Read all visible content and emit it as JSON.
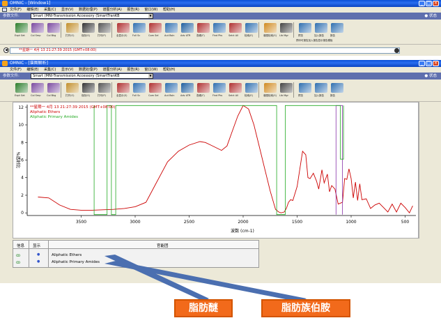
{
  "window1": {
    "title": "OMNIC - [Window1]",
    "menu": [
      "文件(F)",
      "编辑(E)",
      "采集(C)",
      "显示(V)",
      "数据处理(P)",
      "谱图分析(A)",
      "报告(R)",
      "窗口(W)",
      "帮助(H)"
    ],
    "exp_label": "参数文件:",
    "exp_value": "Smart (MNI-Transmission Accessory  (SmartTranKB",
    "status": "状态",
    "spectrum_field": "**星期一 4月 13 21:27:39 2015 (GMT+08:00)"
  },
  "window2": {
    "title": "OMNIC - [谱图解析]",
    "menu": [
      "文件(F)",
      "编辑(E)",
      "采集(C)",
      "显示(V)",
      "数据处理(P)",
      "谱图分析(A)",
      "报告(R)",
      "窗口(W)",
      "帮助(H)"
    ],
    "exp_label": "参数文件:",
    "exp_value": "Smart (MNI-Transmission Accessory  (SmartTranKB",
    "status": "状态"
  },
  "toolbar": [
    {
      "label": "Expt Set",
      "icon": "expt-set-icon",
      "color": "#2b7d2b"
    },
    {
      "label": "Col Smp",
      "icon": "collect-sample-icon",
      "color": "#7a4aa0"
    },
    {
      "label": "Col Bkg",
      "icon": "collect-background-icon",
      "color": "#7a4aa0"
    },
    {
      "label": "打开(O)",
      "icon": "open-icon",
      "color": "#c28f2c"
    },
    {
      "label": "保存(S)",
      "icon": "save-icon",
      "color": "#333333"
    },
    {
      "label": "打印(P)",
      "icon": "print-icon",
      "color": "#555555"
    },
    {
      "label": "全显示(S)",
      "icon": "full-display-icon",
      "color": "#b03030"
    },
    {
      "label": "Full Sc",
      "icon": "full-scale-icon",
      "color": "#2f6fb0"
    },
    {
      "label": "Com Sel",
      "icon": "common-scale-icon",
      "color": "#b03030"
    },
    {
      "label": "Aut Bsln",
      "icon": "auto-baseline-icon",
      "color": "#2f6fb0"
    },
    {
      "label": "Adv ATR",
      "icon": "adv-atr-icon",
      "color": "#1f5f9f"
    },
    {
      "label": "查峰(F)",
      "icon": "find-peaks-icon",
      "color": "#b03030"
    },
    {
      "label": "Find Pks",
      "icon": "find-pks-icon",
      "color": "#2f6fb0"
    },
    {
      "label": "Selct All",
      "icon": "select-all-icon",
      "color": "#b03030"
    },
    {
      "label": "检索(E)",
      "icon": "search-library-icon",
      "color": "#2f6fb0"
    },
    {
      "label": "谱图检索(S)",
      "icon": "spectral-search-icon",
      "color": "#d08a20"
    },
    {
      "label": "Lib Mgr",
      "icon": "library-manager-icon",
      "color": "#444444"
    },
    {
      "label": "预览",
      "icon": "preview-icon",
      "color": "#2f6fb0"
    },
    {
      "label": "加入报告",
      "icon": "add-report-icon",
      "color": "#2f6fb0"
    },
    {
      "label": "报告",
      "icon": "report-icon",
      "color": "#2f6fb0"
    }
  ],
  "toolbar_caption": "预印可报告加入报告显示报告模板",
  "plot": {
    "legend": [
      {
        "text": "**星期一 4月 13 21:27:39 2015 (GMT+08:00)",
        "color": "#cc0000"
      },
      {
        "text": "Aliphatic Ethers",
        "color": "#cc0000"
      },
      {
        "text": "Aliphatic Primary Amides",
        "color": "#22aa22"
      }
    ]
  },
  "chart_data": {
    "type": "line",
    "xlabel": "波数 (cm-1)",
    "ylabel": "%透射比",
    "xlim": [
      4000,
      400
    ],
    "ylim": [
      -0.3,
      12.3
    ],
    "xticks": [
      3500,
      3000,
      2500,
      2000,
      1500,
      1000,
      500
    ],
    "yticks": [
      0,
      2,
      4,
      6,
      8,
      10,
      12
    ],
    "series": [
      {
        "name": "**星期一 4月 13 21:27:39 2015 (GMT+08:00)",
        "color": "#cc0000",
        "x": [
          3900,
          3800,
          3700,
          3600,
          3500,
          3400,
          3300,
          3200,
          3100,
          3000,
          2900,
          2800,
          2700,
          2600,
          2500,
          2400,
          2350,
          2300,
          2200,
          2150,
          2100,
          2050,
          2000,
          1950,
          1900,
          1850,
          1800,
          1750,
          1700,
          1670,
          1650,
          1620,
          1600,
          1580,
          1560,
          1540,
          1500,
          1450,
          1420,
          1400,
          1380,
          1350,
          1320,
          1300,
          1270,
          1250,
          1220,
          1200,
          1180,
          1150,
          1120,
          1100,
          1080,
          1060,
          1040,
          1020,
          1000,
          980,
          960,
          940,
          920,
          900,
          860,
          820,
          780,
          740,
          700,
          660,
          620,
          580,
          540,
          500,
          460,
          430
        ],
        "y": [
          1.8,
          1.7,
          0.9,
          0.4,
          0.3,
          0.3,
          0.35,
          0.4,
          0.5,
          0.7,
          1.2,
          3.5,
          5.8,
          7.0,
          7.7,
          8.1,
          8.0,
          7.7,
          7.1,
          7.6,
          9.3,
          11.0,
          12.2,
          11.8,
          10.0,
          7.5,
          5.0,
          2.5,
          0.4,
          0.1,
          0.0,
          0.1,
          0.5,
          1.2,
          1.5,
          1.4,
          3.0,
          7.0,
          6.6,
          4.0,
          3.9,
          4.5,
          3.6,
          2.7,
          4.9,
          3.4,
          4.4,
          2.4,
          3.1,
          2.7,
          1.0,
          1.1,
          1.2,
          3.9,
          3.8,
          5.0,
          3.9,
          1.7,
          3.5,
          1.4,
          3.3,
          1.5,
          1.6,
          0.5,
          0.9,
          1.1,
          0.6,
          0.1,
          1.0,
          0.1,
          1.1,
          0.6,
          0.0,
          0.8
        ]
      },
      {
        "name": "Aliphatic Ethers",
        "color": "#8833aa",
        "x": [
          1140,
          1140,
          1080,
          1080
        ],
        "y": [
          -0.2,
          12.2,
          12.2,
          -0.2
        ]
      },
      {
        "name": "Aliphatic Primary Amides",
        "color": "#22aa22",
        "x": [
          3380,
          3380,
          3260,
          3260,
          3220,
          3220,
          3180,
          3180,
          3150,
          3150,
          1690,
          1690,
          1610,
          1610,
          1100,
          1100,
          1070,
          1070
        ],
        "y": [
          12.2,
          -0.2,
          -0.2,
          12.2,
          12.2,
          -0.2,
          -0.2,
          12.2,
          12.2,
          12.2,
          12.2,
          -0.2,
          -0.2,
          12.2,
          12.2,
          6.1,
          6.1,
          12.2
        ]
      }
    ]
  },
  "info_panel": {
    "col_info": "信息",
    "col_display": "显示",
    "col_group": "官能团",
    "rows": [
      {
        "display": "●",
        "group": "Aliphatic Ethers"
      },
      {
        "display": "●",
        "group": "Aliphatic Primary Amides"
      }
    ]
  },
  "callouts": {
    "ether": "脂肪醚",
    "amide": "脂肪族伯胺"
  }
}
